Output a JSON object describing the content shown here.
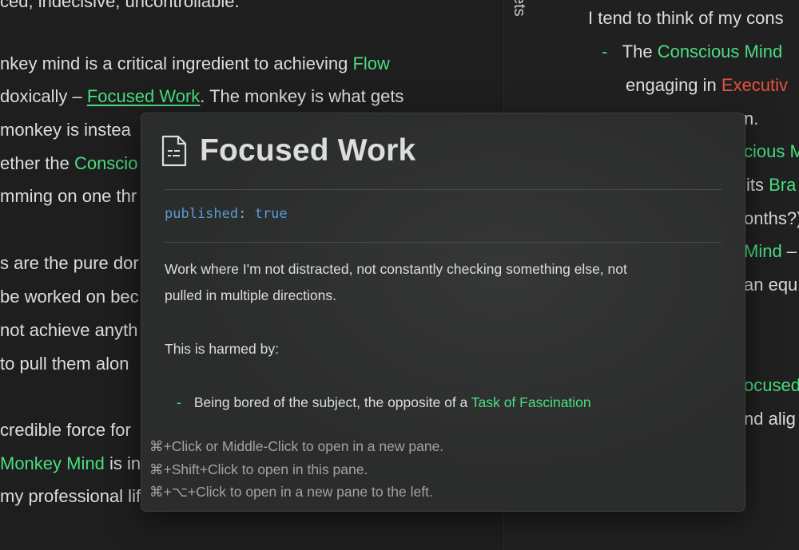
{
  "left_pane": {
    "lines": [
      {
        "pre": "ced, indecisive, uncontrollable.",
        "link": "",
        "post": ""
      },
      {
        "pre": "nkey mind is a critical ingredient to achieving ",
        "link": "Flow",
        "post": ""
      },
      {
        "pre": "doxically – ",
        "link": "Focused Work",
        "post": ". The monkey is what gets"
      },
      {
        "pre": "monkey is instea",
        "link": "",
        "post": ""
      },
      {
        "pre": "ether the ",
        "link": "Conscio",
        "post": ""
      },
      {
        "pre": "mming on one thr",
        "link": "",
        "post": ""
      },
      {
        "pre": "s are the pure dor",
        "link": "",
        "post": ""
      },
      {
        "pre": "be worked on bec",
        "link": "",
        "post": ""
      },
      {
        "pre": "not achieve anyth",
        "link": "",
        "post": ""
      },
      {
        "pre": "to pull them alon",
        "link": "",
        "post": ""
      },
      {
        "pre": "credible force for",
        "link": "",
        "post": ""
      },
      {
        "pre": "",
        "link": "Monkey Mind",
        "post": " is in"
      },
      {
        "pre": "my professional lif",
        "link": "",
        "post": ""
      }
    ]
  },
  "right_pane": {
    "vertical_tab": "ets",
    "line1": "I tend to think of my cons",
    "bullet1_pre": "The ",
    "bullet1_link": "Conscious Mind",
    "line3_pre": "engaging in ",
    "line3_red": "Executiv",
    "line4": "n.",
    "line5_link": "cious M",
    "line6_pre": "its ",
    "line6_link": "Bra",
    "line7": "onths?)",
    "line8_link": "Mind",
    "line8_post": " – A",
    "line9": "an equ",
    "line10_link": "ocused",
    "line11": "nd alig"
  },
  "popover": {
    "icon": "file-icon",
    "title": "Focused Work",
    "property": {
      "key": "published",
      "value": "true"
    },
    "paragraph_line1": "Work where I'm not distracted, not constantly checking something else, not",
    "paragraph_line2": "pulled in multiple directions.",
    "harmed_by": "This is harmed by:",
    "bullet_pre": "Being bored of the subject, the opposite of a ",
    "bullet_link": "Task of Fascination",
    "hints": [
      "⌘+Click or Middle-Click to open in a new pane.",
      "⌘+Shift+Click to open in this pane.",
      "⌘+⌥+Click to open in a new pane to the left."
    ]
  },
  "colors": {
    "link": "#4ade80",
    "background": "#1e1e1e",
    "popover": "#2b2c2c",
    "property": "#5a9bd5",
    "red": "#e5533f"
  }
}
